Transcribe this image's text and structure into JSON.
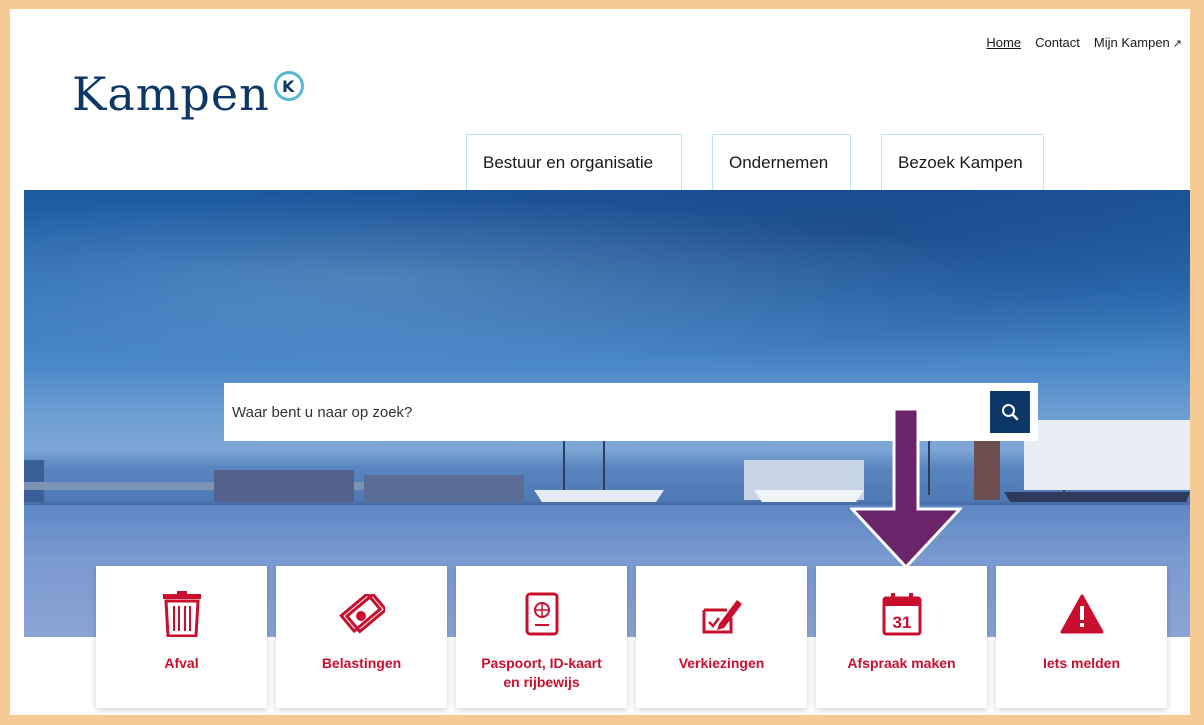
{
  "header": {
    "logo_text": "Kampen",
    "logo_badge": "K",
    "top_links": [
      {
        "label": "Home"
      },
      {
        "label": "Contact"
      },
      {
        "label": "Mijn Kampen"
      }
    ],
    "external_icon": "external-link-icon"
  },
  "nav": {
    "tabs": [
      {
        "label": "Bestuur en organisatie"
      },
      {
        "label": "Ondernemen"
      },
      {
        "label": "Bezoek Kampen"
      }
    ]
  },
  "search": {
    "placeholder": "Waar bent u naar op zoek?",
    "icon": "search-icon"
  },
  "tiles": [
    {
      "label": "Afval",
      "icon": "trash-bin-icon"
    },
    {
      "label": "Belastingen",
      "icon": "money-icon"
    },
    {
      "label_lines": [
        "Paspoort, ID-kaart",
        "en rijbewijs"
      ],
      "icon": "passport-icon"
    },
    {
      "label": "Verkiezingen",
      "icon": "vote-pencil-icon"
    },
    {
      "label": "Afspraak maken",
      "icon": "calendar-icon",
      "calendar_day": "31"
    },
    {
      "label": "Iets melden",
      "icon": "warning-icon"
    }
  ],
  "colors": {
    "accent_red": "#c8102e",
    "navy": "#0c3766",
    "logo_cyan": "#58b7d9",
    "arrow_purple": "#6a2469",
    "page_border": "#f5cb93"
  }
}
